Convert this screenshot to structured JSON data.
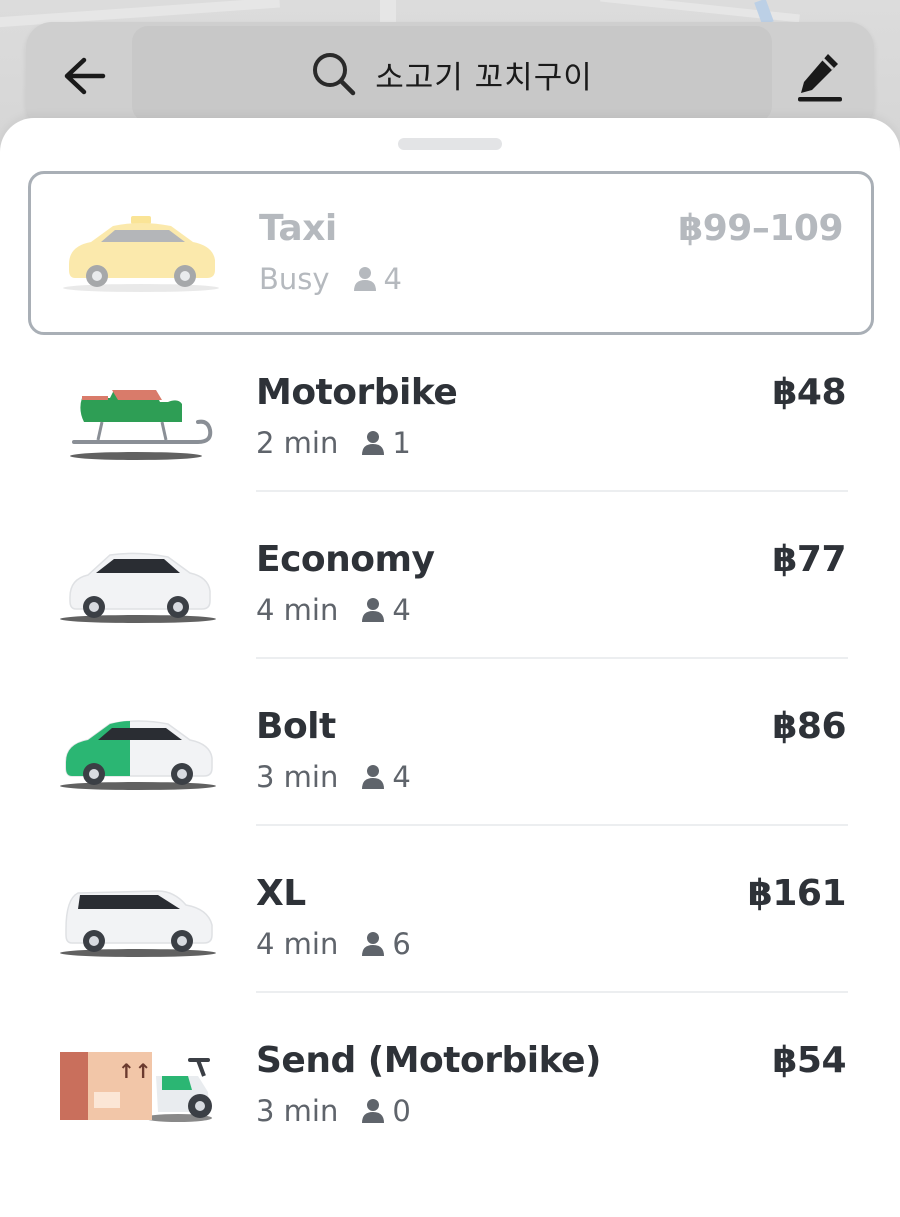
{
  "search": {
    "query": "소고기 꼬치구이"
  },
  "icons": {
    "back": "arrow-left-icon",
    "search": "search-icon",
    "edit": "pencil-icon",
    "person": "person-icon"
  },
  "colors": {
    "bolt_green": "#2bb673",
    "text_primary": "#2e3238",
    "text_secondary": "#5f646b",
    "disabled": "#b5b9be",
    "selected_border": "#a9afb6"
  },
  "rides": [
    {
      "name": "Taxi",
      "eta": "Busy",
      "capacity": "4",
      "price": "฿99–109",
      "vehicle": "taxi-car",
      "selected": true
    },
    {
      "name": "Motorbike",
      "eta": "2 min",
      "capacity": "1",
      "price": "฿48",
      "vehicle": "sleigh",
      "selected": false
    },
    {
      "name": "Economy",
      "eta": "4 min",
      "capacity": "4",
      "price": "฿77",
      "vehicle": "white-car",
      "selected": false
    },
    {
      "name": "Bolt",
      "eta": "3 min",
      "capacity": "4",
      "price": "฿86",
      "vehicle": "green-white-car",
      "selected": false
    },
    {
      "name": "XL",
      "eta": "4 min",
      "capacity": "6",
      "price": "฿161",
      "vehicle": "white-van",
      "selected": false
    },
    {
      "name": "Send (Motorbike)",
      "eta": "3 min",
      "capacity": "0",
      "price": "฿54",
      "vehicle": "parcel-scooter",
      "selected": false
    }
  ]
}
